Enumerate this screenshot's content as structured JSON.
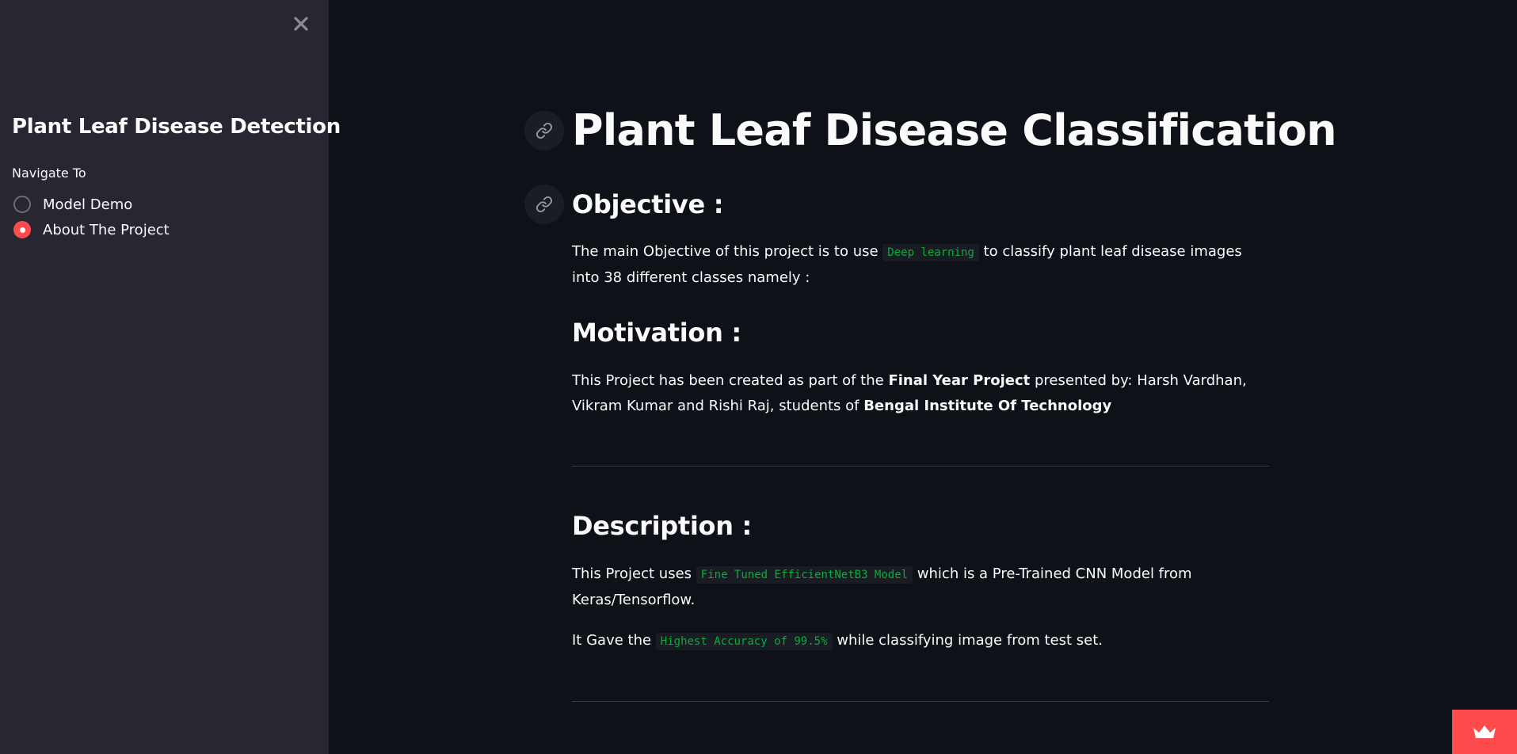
{
  "sidebar": {
    "title": "Plant Leaf Disease Detection",
    "nav_label": "Navigate To",
    "options": [
      {
        "label": "Model Demo",
        "selected": false
      },
      {
        "label": "About The Project",
        "selected": true
      }
    ]
  },
  "main": {
    "title": "Plant Leaf Disease Classification",
    "objective": {
      "heading": "Objective :",
      "text_1": "The main Objective of this project is to use ",
      "code": "Deep learning",
      "text_2": " to classify plant leaf disease images into 38 different classes namely :"
    },
    "motivation": {
      "heading": "Motivation :",
      "text_1": "This Project has been created as part of the ",
      "bold_1": "Final Year Project",
      "text_2": " presented by: Harsh Vardhan, Vikram Kumar and Rishi Raj, students of ",
      "bold_2": "Bengal Institute Of Technology"
    },
    "description": {
      "heading": "Description :",
      "p1_text_1": "This Project uses ",
      "p1_code": "Fine Tuned EfficientNetB3 Model",
      "p1_text_2": " which is a Pre-Trained CNN Model from Keras/Tensorflow.",
      "p2_text_1": "It Gave the ",
      "p2_code": "Highest Accuracy of 99.5%",
      "p2_text_2": " while classifying image from test set."
    }
  },
  "colors": {
    "accent": "#ff4b4b",
    "code_text": "#09ab3b",
    "background": "#0e1117",
    "sidebar_bg": "#262730"
  },
  "icons": {
    "close": "close-icon",
    "anchor": "link-icon",
    "badge": "crown-icon"
  }
}
